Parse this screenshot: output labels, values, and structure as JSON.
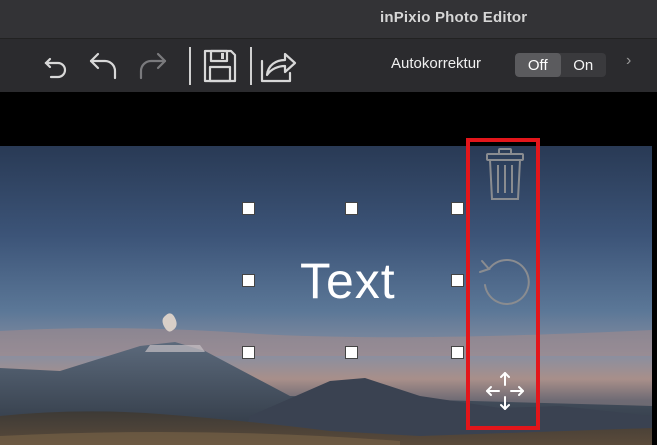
{
  "app": {
    "title": "inPixio Photo Editor"
  },
  "toolbar": {
    "icons": [
      "undo-icon",
      "undo-step-icon",
      "redo-icon",
      "save-icon",
      "share-icon"
    ],
    "autocorrect_label": "Autokorrektur",
    "toggle": {
      "off_label": "Off",
      "on_label": "On",
      "selected": "Off"
    },
    "more_label": "›"
  },
  "canvas": {
    "text_label": "Text"
  },
  "side_tools": {
    "icons": [
      "trash-icon",
      "rotate-icon",
      "move-icon"
    ],
    "highlight_color": "#e3161b"
  },
  "colors": {
    "titlebar_bg": "#333336",
    "toolbar_bg": "#2b2b2e",
    "toggle_selected": "#5b5b5e"
  }
}
